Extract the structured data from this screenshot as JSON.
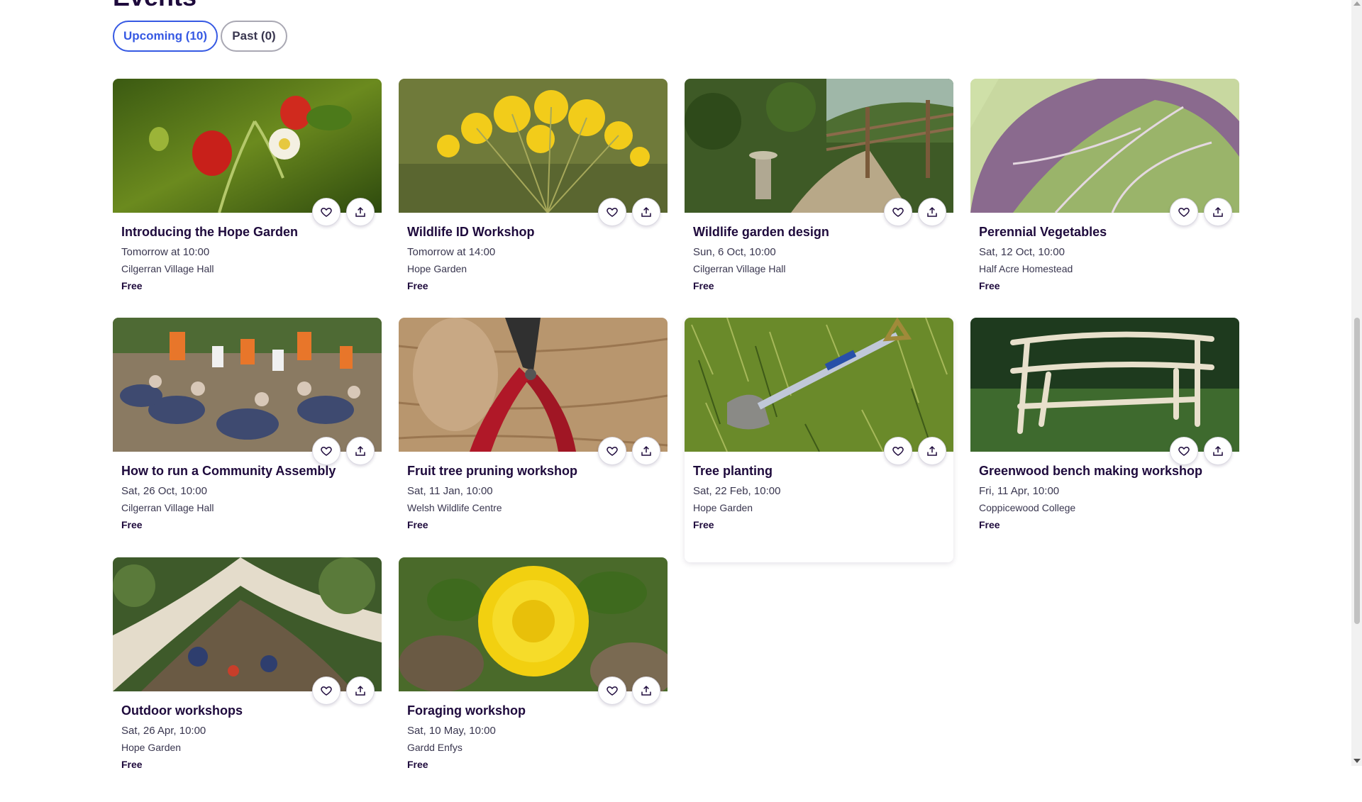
{
  "page": {
    "title": "Events"
  },
  "tabs": {
    "upcoming": "Upcoming (10)",
    "past": "Past (0)"
  },
  "colors": {
    "accent": "#3659e3",
    "text": "#1e0a3c",
    "muted": "#39364f"
  },
  "events": [
    {
      "title": "Introducing the Hope Garden",
      "date": "Tomorrow at 10:00",
      "venue": "Cilgerran Village Hall",
      "price": "Free"
    },
    {
      "title": "Wildlife ID Workshop",
      "date": "Tomorrow at 14:00",
      "venue": "Hope Garden",
      "price": "Free"
    },
    {
      "title": "Wildlife garden design",
      "date": "Sun, 6 Oct, 10:00",
      "venue": "Cilgerran Village Hall",
      "price": "Free"
    },
    {
      "title": "Perennial Vegetables",
      "date": "Sat, 12 Oct, 10:00",
      "venue": "Half Acre Homestead",
      "price": "Free"
    },
    {
      "title": "How to run a Community Assembly",
      "date": "Sat, 26 Oct, 10:00",
      "venue": "Cilgerran Village Hall",
      "price": "Free"
    },
    {
      "title": "Fruit tree pruning workshop",
      "date": "Sat, 11 Jan, 10:00",
      "venue": "Welsh Wildlife Centre",
      "price": "Free"
    },
    {
      "title": "Tree planting",
      "date": "Sat, 22 Feb, 10:00",
      "venue": "Hope Garden",
      "price": "Free"
    },
    {
      "title": "Greenwood bench making workshop",
      "date": "Fri, 11 Apr, 10:00",
      "venue": "Coppicewood College",
      "price": "Free"
    },
    {
      "title": "Outdoor workshops",
      "date": "Sat, 26 Apr, 10:00",
      "venue": "Hope Garden",
      "price": "Free"
    },
    {
      "title": "Foraging workshop",
      "date": "Sat, 10 May, 10:00",
      "venue": "Gardd Enfys",
      "price": "Free"
    }
  ],
  "icons": {
    "like": "heart-icon",
    "share": "share-icon"
  }
}
